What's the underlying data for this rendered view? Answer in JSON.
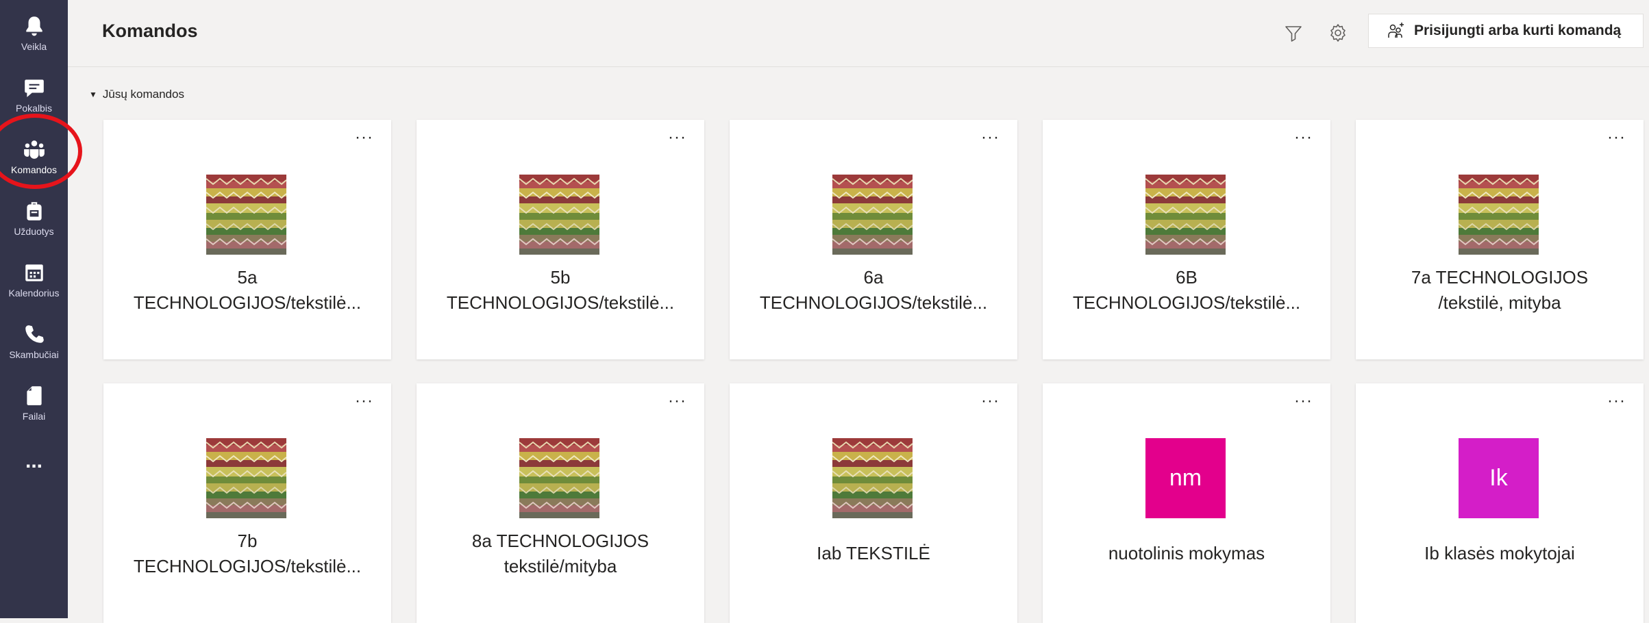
{
  "rail": {
    "items": [
      {
        "label": "Veikla",
        "icon": "bell-icon"
      },
      {
        "label": "Pokalbis",
        "icon": "chat-icon"
      },
      {
        "label": "Komandos",
        "icon": "teams-icon",
        "active": true
      },
      {
        "label": "Užduotys",
        "icon": "backpack-icon"
      },
      {
        "label": "Kalendorius",
        "icon": "calendar-icon"
      },
      {
        "label": "Skambučiai",
        "icon": "phone-icon"
      },
      {
        "label": "Failai",
        "icon": "file-icon"
      },
      {
        "label": "...",
        "icon": "more-apps-icon"
      }
    ]
  },
  "header": {
    "title": "Komandos",
    "join_label": "Prisijungti arba kurti komandą"
  },
  "section": {
    "label": "Jūsų komandos"
  },
  "teams": [
    {
      "line1": "5a",
      "line2": "TECHNOLOGIJOS/tekstilė...",
      "avatar": "pattern"
    },
    {
      "line1": "5b",
      "line2": "TECHNOLOGIJOS/tekstilė...",
      "avatar": "pattern"
    },
    {
      "line1": "6a",
      "line2": "TECHNOLOGIJOS/tekstilė...",
      "avatar": "pattern"
    },
    {
      "line1": "6B",
      "line2": "TECHNOLOGIJOS/tekstilė...",
      "avatar": "pattern"
    },
    {
      "line1": "7a TECHNOLOGIJOS",
      "line2": "/tekstilė, mityba",
      "avatar": "pattern"
    },
    {
      "line1": "7b",
      "line2": "TECHNOLOGIJOS/tekstilė...",
      "avatar": "pattern"
    },
    {
      "line1": "8a TECHNOLOGIJOS",
      "line2": "tekstilė/mityba",
      "avatar": "pattern"
    },
    {
      "line1": "Iab TEKSTILĖ",
      "line2": "",
      "avatar": "pattern"
    },
    {
      "line1": "nuotolinis mokymas",
      "line2": "",
      "avatar": "initials",
      "initials": "nm",
      "color": "#e3008c"
    },
    {
      "line1": "Ib klasės mokytojai",
      "line2": "",
      "avatar": "initials",
      "initials": "Ik",
      "color": "#d41ec8"
    }
  ],
  "more_label": "···",
  "colors": {
    "rail": "#33344a",
    "highlight": "#e6141b"
  }
}
